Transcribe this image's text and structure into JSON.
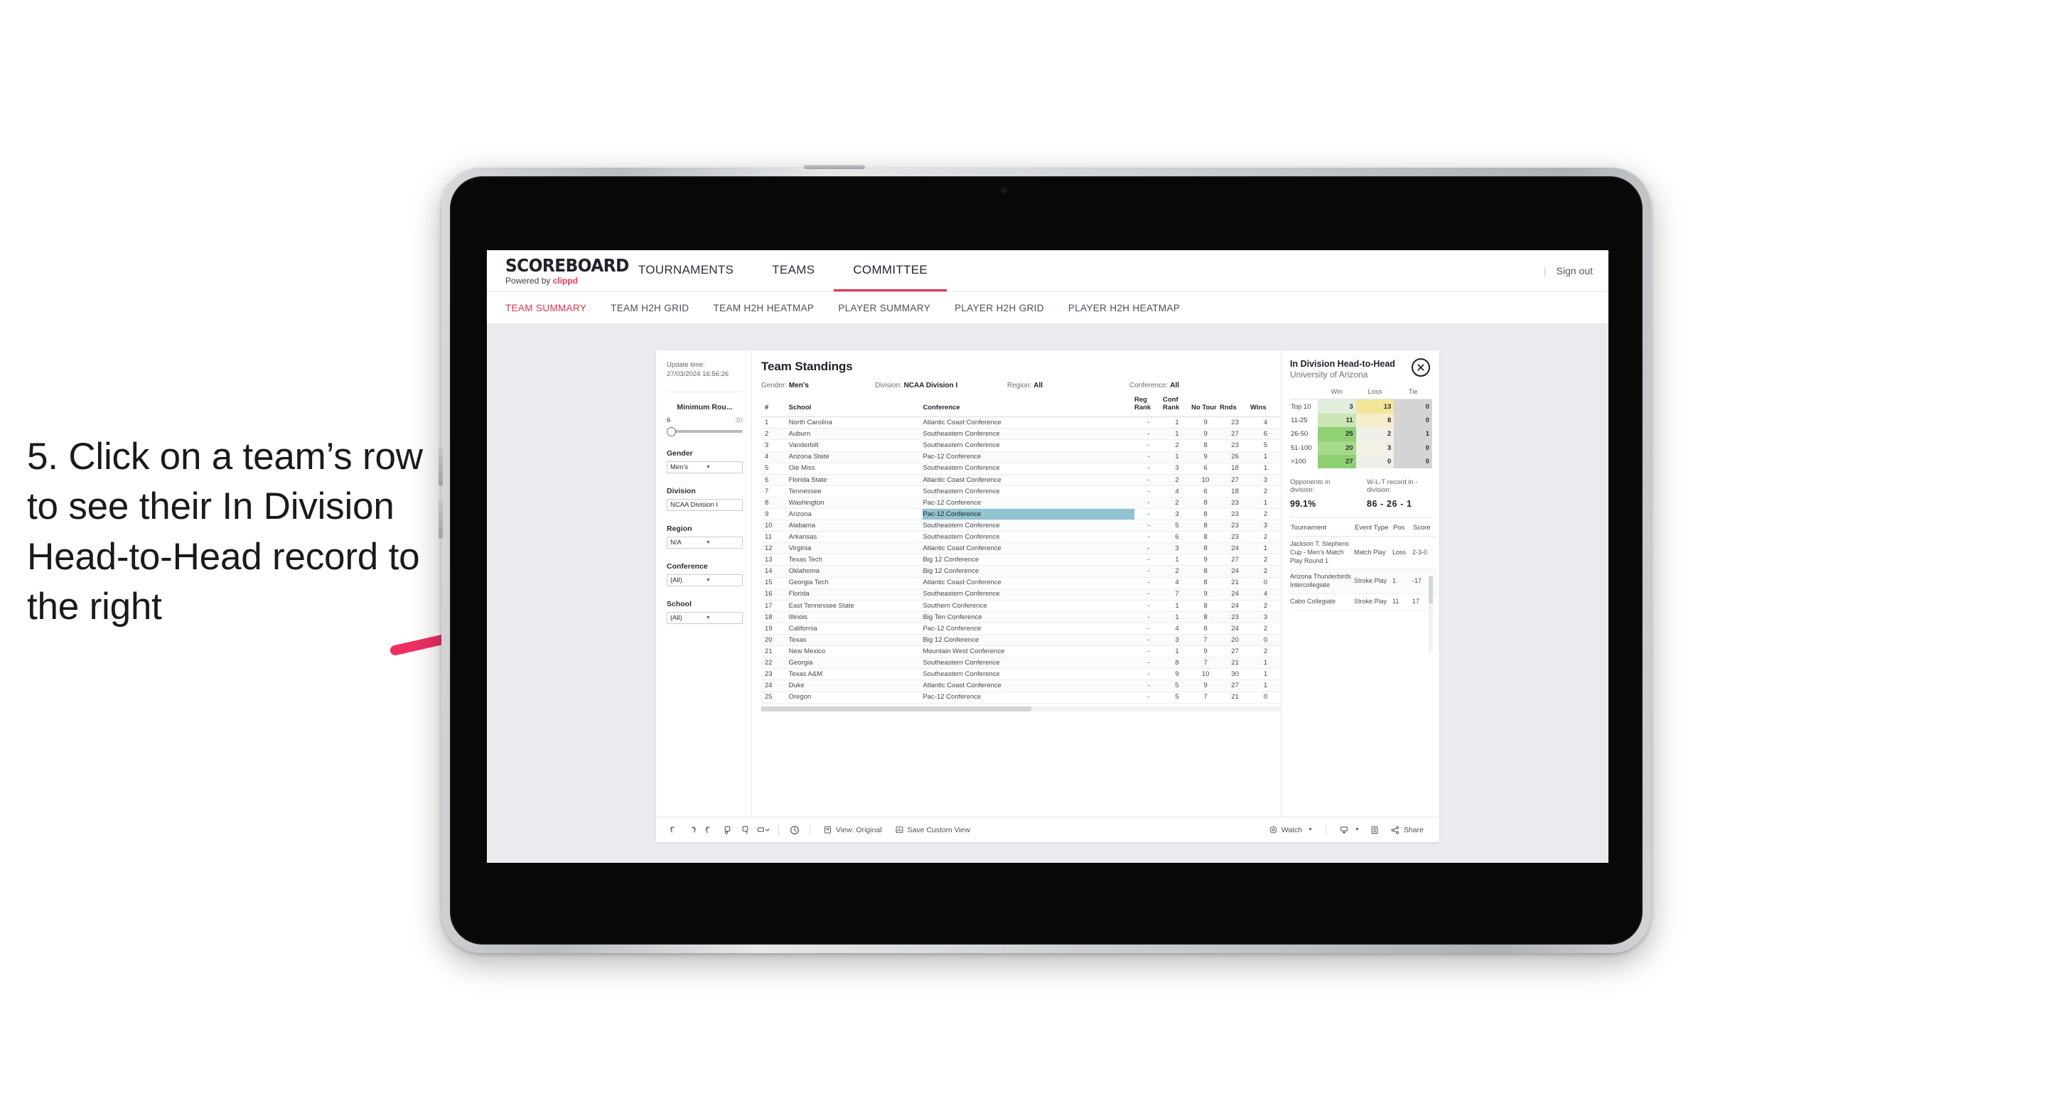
{
  "annotation": {
    "text": "5. Click on a team’s row to see their In Division Head-to-Head record to the right",
    "arrow_color": "#ef2f63"
  },
  "app": {
    "brand": {
      "name": "SCOREBOARD",
      "powered_prefix": "Powered by",
      "powered_by": "clippd"
    },
    "nav": [
      {
        "label": "TOURNAMENTS",
        "active": false
      },
      {
        "label": "TEAMS",
        "active": false
      },
      {
        "label": "COMMITTEE",
        "active": true
      }
    ],
    "sign_out": "Sign out",
    "divider": "|",
    "subtabs": [
      {
        "label": "TEAM SUMMARY",
        "active": true
      },
      {
        "label": "TEAM H2H GRID",
        "active": false
      },
      {
        "label": "TEAM H2H HEATMAP",
        "active": false
      },
      {
        "label": "PLAYER SUMMARY",
        "active": false
      },
      {
        "label": "PLAYER H2H GRID",
        "active": false
      },
      {
        "label": "PLAYER H2H HEATMAP",
        "active": false
      }
    ]
  },
  "rail": {
    "update_time_label": "Update time:",
    "update_time_value": "27/03/2024 16:56:26",
    "min_rounds": {
      "label": "Minimum Rou...",
      "min": "6",
      "max": "30"
    },
    "filters": [
      {
        "label": "Gender",
        "value": "Men’s"
      },
      {
        "label": "Division",
        "value": "NCAA Division I"
      },
      {
        "label": "Region",
        "value": "N/A"
      },
      {
        "label": "Conference",
        "value": "(All)"
      },
      {
        "label": "School",
        "value": "(All)"
      }
    ]
  },
  "sheet": {
    "title": "Team Standings",
    "filter_summary": [
      {
        "key": "Gender:",
        "value": "Men’s"
      },
      {
        "key": "Division:",
        "value": "NCAA Division I"
      },
      {
        "key": "Region:",
        "value": "All"
      },
      {
        "key": "Conference:",
        "value": "All"
      }
    ],
    "columns": [
      "#",
      "School",
      "Conference",
      "Reg Rank",
      "Conf Rank",
      "No Tour",
      "Rnds",
      "Wins"
    ],
    "rows": [
      {
        "num": "1",
        "school": "North Carolina",
        "conference": "Atlantic Coast Conference",
        "reg": "-",
        "conf": "1",
        "notour": "9",
        "rnds": "23",
        "wins": "4",
        "selected": false
      },
      {
        "num": "2",
        "school": "Auburn",
        "conference": "Southeastern Conference",
        "reg": "-",
        "conf": "1",
        "notour": "9",
        "rnds": "27",
        "wins": "6",
        "selected": false
      },
      {
        "num": "3",
        "school": "Vanderbilt",
        "conference": "Southeastern Conference",
        "reg": "-",
        "conf": "2",
        "notour": "8",
        "rnds": "23",
        "wins": "5",
        "selected": false
      },
      {
        "num": "4",
        "school": "Arizona State",
        "conference": "Pac-12 Conference",
        "reg": "-",
        "conf": "1",
        "notour": "9",
        "rnds": "26",
        "wins": "1",
        "selected": false
      },
      {
        "num": "5",
        "school": "Ole Miss",
        "conference": "Southeastern Conference",
        "reg": "-",
        "conf": "3",
        "notour": "6",
        "rnds": "18",
        "wins": "1",
        "selected": false
      },
      {
        "num": "6",
        "school": "Florida State",
        "conference": "Atlantic Coast Conference",
        "reg": "-",
        "conf": "2",
        "notour": "10",
        "rnds": "27",
        "wins": "3",
        "selected": false
      },
      {
        "num": "7",
        "school": "Tennessee",
        "conference": "Southeastern Conference",
        "reg": "-",
        "conf": "4",
        "notour": "6",
        "rnds": "18",
        "wins": "2",
        "selected": false
      },
      {
        "num": "8",
        "school": "Washington",
        "conference": "Pac-12 Conference",
        "reg": "-",
        "conf": "2",
        "notour": "8",
        "rnds": "23",
        "wins": "1",
        "selected": false
      },
      {
        "num": "9",
        "school": "Arizona",
        "conference": "Pac-12 Conference",
        "reg": "-",
        "conf": "3",
        "notour": "8",
        "rnds": "23",
        "wins": "2",
        "selected": true
      },
      {
        "num": "10",
        "school": "Alabama",
        "conference": "Southeastern Conference",
        "reg": "-",
        "conf": "5",
        "notour": "8",
        "rnds": "23",
        "wins": "3",
        "selected": false
      },
      {
        "num": "11",
        "school": "Arkansas",
        "conference": "Southeastern Conference",
        "reg": "-",
        "conf": "6",
        "notour": "8",
        "rnds": "23",
        "wins": "2",
        "selected": false
      },
      {
        "num": "12",
        "school": "Virginia",
        "conference": "Atlantic Coast Conference",
        "reg": "-",
        "conf": "3",
        "notour": "8",
        "rnds": "24",
        "wins": "1",
        "selected": false
      },
      {
        "num": "13",
        "school": "Texas Tech",
        "conference": "Big 12 Conference",
        "reg": "-",
        "conf": "1",
        "notour": "9",
        "rnds": "27",
        "wins": "2",
        "selected": false
      },
      {
        "num": "14",
        "school": "Oklahoma",
        "conference": "Big 12 Conference",
        "reg": "-",
        "conf": "2",
        "notour": "8",
        "rnds": "24",
        "wins": "2",
        "selected": false
      },
      {
        "num": "15",
        "school": "Georgia Tech",
        "conference": "Atlantic Coast Conference",
        "reg": "-",
        "conf": "4",
        "notour": "8",
        "rnds": "21",
        "wins": "0",
        "selected": false
      },
      {
        "num": "16",
        "school": "Florida",
        "conference": "Southeastern Conference",
        "reg": "-",
        "conf": "7",
        "notour": "9",
        "rnds": "24",
        "wins": "4",
        "selected": false
      },
      {
        "num": "17",
        "school": "East Tennessee State",
        "conference": "Southern Conference",
        "reg": "-",
        "conf": "1",
        "notour": "8",
        "rnds": "24",
        "wins": "2",
        "selected": false
      },
      {
        "num": "18",
        "school": "Illinois",
        "conference": "Big Ten Conference",
        "reg": "-",
        "conf": "1",
        "notour": "8",
        "rnds": "23",
        "wins": "3",
        "selected": false
      },
      {
        "num": "19",
        "school": "California",
        "conference": "Pac-12 Conference",
        "reg": "-",
        "conf": "4",
        "notour": "8",
        "rnds": "24",
        "wins": "2",
        "selected": false
      },
      {
        "num": "20",
        "school": "Texas",
        "conference": "Big 12 Conference",
        "reg": "-",
        "conf": "3",
        "notour": "7",
        "rnds": "20",
        "wins": "0",
        "selected": false
      },
      {
        "num": "21",
        "school": "New Mexico",
        "conference": "Mountain West Conference",
        "reg": "-",
        "conf": "1",
        "notour": "9",
        "rnds": "27",
        "wins": "2",
        "selected": false
      },
      {
        "num": "22",
        "school": "Georgia",
        "conference": "Southeastern Conference",
        "reg": "-",
        "conf": "8",
        "notour": "7",
        "rnds": "21",
        "wins": "1",
        "selected": false
      },
      {
        "num": "23",
        "school": "Texas A&M",
        "conference": "Southeastern Conference",
        "reg": "-",
        "conf": "9",
        "notour": "10",
        "rnds": "30",
        "wins": "1",
        "selected": false
      },
      {
        "num": "24",
        "school": "Duke",
        "conference": "Atlantic Coast Conference",
        "reg": "-",
        "conf": "5",
        "notour": "9",
        "rnds": "27",
        "wins": "1",
        "selected": false
      },
      {
        "num": "25",
        "school": "Oregon",
        "conference": "Pac-12 Conference",
        "reg": "-",
        "conf": "5",
        "notour": "7",
        "rnds": "21",
        "wins": "0",
        "selected": false
      }
    ]
  },
  "right_panel": {
    "title": "In Division Head-to-Head",
    "subtitle": "University of Arizona",
    "close_icon": "close-icon",
    "h2h_headers": [
      "",
      "Win",
      "Loss",
      "Tie"
    ],
    "h2h_rows": [
      {
        "band": "Top 10",
        "win": "3",
        "loss": "13",
        "tie": "0",
        "win_color": "#e2edde",
        "loss_color": "#f2e598",
        "tie_color": "#d4d4d4"
      },
      {
        "band": "11-25",
        "win": "11",
        "loss": "8",
        "tie": "0",
        "win_color": "#c9e5b6",
        "loss_color": "#f5edcb",
        "tie_color": "#d4d4d4"
      },
      {
        "band": "26-50",
        "win": "25",
        "loss": "2",
        "tie": "1",
        "win_color": "#8fd173",
        "loss_color": "#f0efe9",
        "tie_color": "#d4d4d4"
      },
      {
        "band": "51-100",
        "win": "20",
        "loss": "3",
        "tie": "0",
        "win_color": "#a5da8a",
        "loss_color": "#f3f0e4",
        "tie_color": "#d4d4d4"
      },
      {
        "band": ">100",
        "win": "27",
        "loss": "0",
        "tie": "0",
        "win_color": "#8ed071",
        "loss_color": "#eff0ec",
        "tie_color": "#d4d4d4"
      }
    ],
    "stats": [
      {
        "label": "Opponents in division:",
        "value": "99.1%"
      },
      {
        "label": "W-L-T record in -division:",
        "value": "86 - 26 - 1"
      }
    ],
    "tournament_headers": [
      "Tournament",
      "Event Type",
      "Pos",
      "Score"
    ],
    "tournaments": [
      {
        "name": "Jackson T. Stephens Cup - Men’s Match Play Round 1",
        "event_type": "Match Play",
        "pos": "Loss",
        "score": "2-3-0"
      },
      {
        "name": "Arizona Thunderbirds Intercollegiate",
        "event_type": "Stroke Play",
        "pos": "1",
        "score": "-17"
      },
      {
        "name": "Cabo Collegiate",
        "event_type": "Stroke Play",
        "pos": "11",
        "score": "17"
      }
    ]
  },
  "toolbar": {
    "icons": [
      "undo-icon",
      "redo-icon",
      "revert-icon",
      "pause-icon",
      "refresh-icon",
      "device-layout-icon"
    ],
    "clock_icon": "clock-icon",
    "view_label": "View: Original",
    "save_custom_view_label": "Save Custom View",
    "watch_label": "Watch",
    "share_label": "Share",
    "download_icon": "download-icon",
    "fullscreen_icon": "fullscreen-icon"
  },
  "chart_data": {
    "type": "heatmap",
    "title": "In Division Head-to-Head",
    "subtitle": "University of Arizona",
    "xlabel": "",
    "ylabel": "",
    "columns": [
      "Win",
      "Loss",
      "Tie"
    ],
    "rows": [
      "Top 10",
      "11-25",
      "26-50",
      "51-100",
      ">100"
    ],
    "values": [
      [
        3,
        13,
        0
      ],
      [
        11,
        8,
        0
      ],
      [
        25,
        2,
        1
      ],
      [
        20,
        3,
        0
      ],
      [
        27,
        0,
        0
      ]
    ],
    "totals": {
      "wins": 86,
      "losses": 26,
      "ties": 1,
      "opponents_in_division_pct": 99.1
    }
  }
}
